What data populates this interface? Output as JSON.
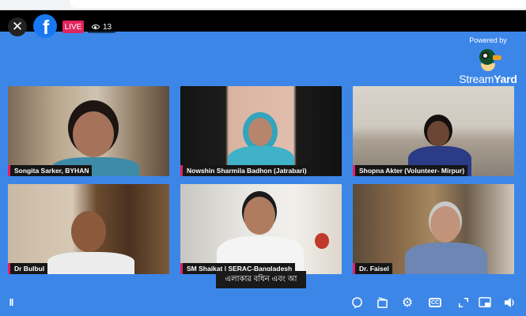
{
  "player": {
    "live_label": "LIVE",
    "viewer_count": "13",
    "brand_top": "Powered by",
    "brand_name_light": "Stream",
    "brand_name_bold": "Yard"
  },
  "participants": [
    {
      "name": "Songita Sarker, BYHAN"
    },
    {
      "name": "Nowshin Sharmila Badhon (Jatrabari)"
    },
    {
      "name": "Shopna Akter (Volunteer- Mirpur)"
    },
    {
      "name": "Dr Bulbul"
    },
    {
      "name": "SM Shaikat | SERAC-Bangladesh"
    },
    {
      "name": "Dr. Faisel"
    }
  ],
  "caption": "এলাকার বধিন এবং আ",
  "icons": {
    "close": "close-icon",
    "pause": "pause-icon",
    "chat": "chat-icon",
    "clip": "clip-icon",
    "settings": "gear-icon",
    "captions": "cc-icon",
    "fullscreen": "fullscreen-icon",
    "pip": "picture-in-picture-icon",
    "volume": "volume-icon"
  },
  "colors": {
    "stage_background": "#3c86e8",
    "live_badge": "#e0245e",
    "facebook_blue": "#1877f2",
    "nametag_accent": "#e91e63"
  }
}
